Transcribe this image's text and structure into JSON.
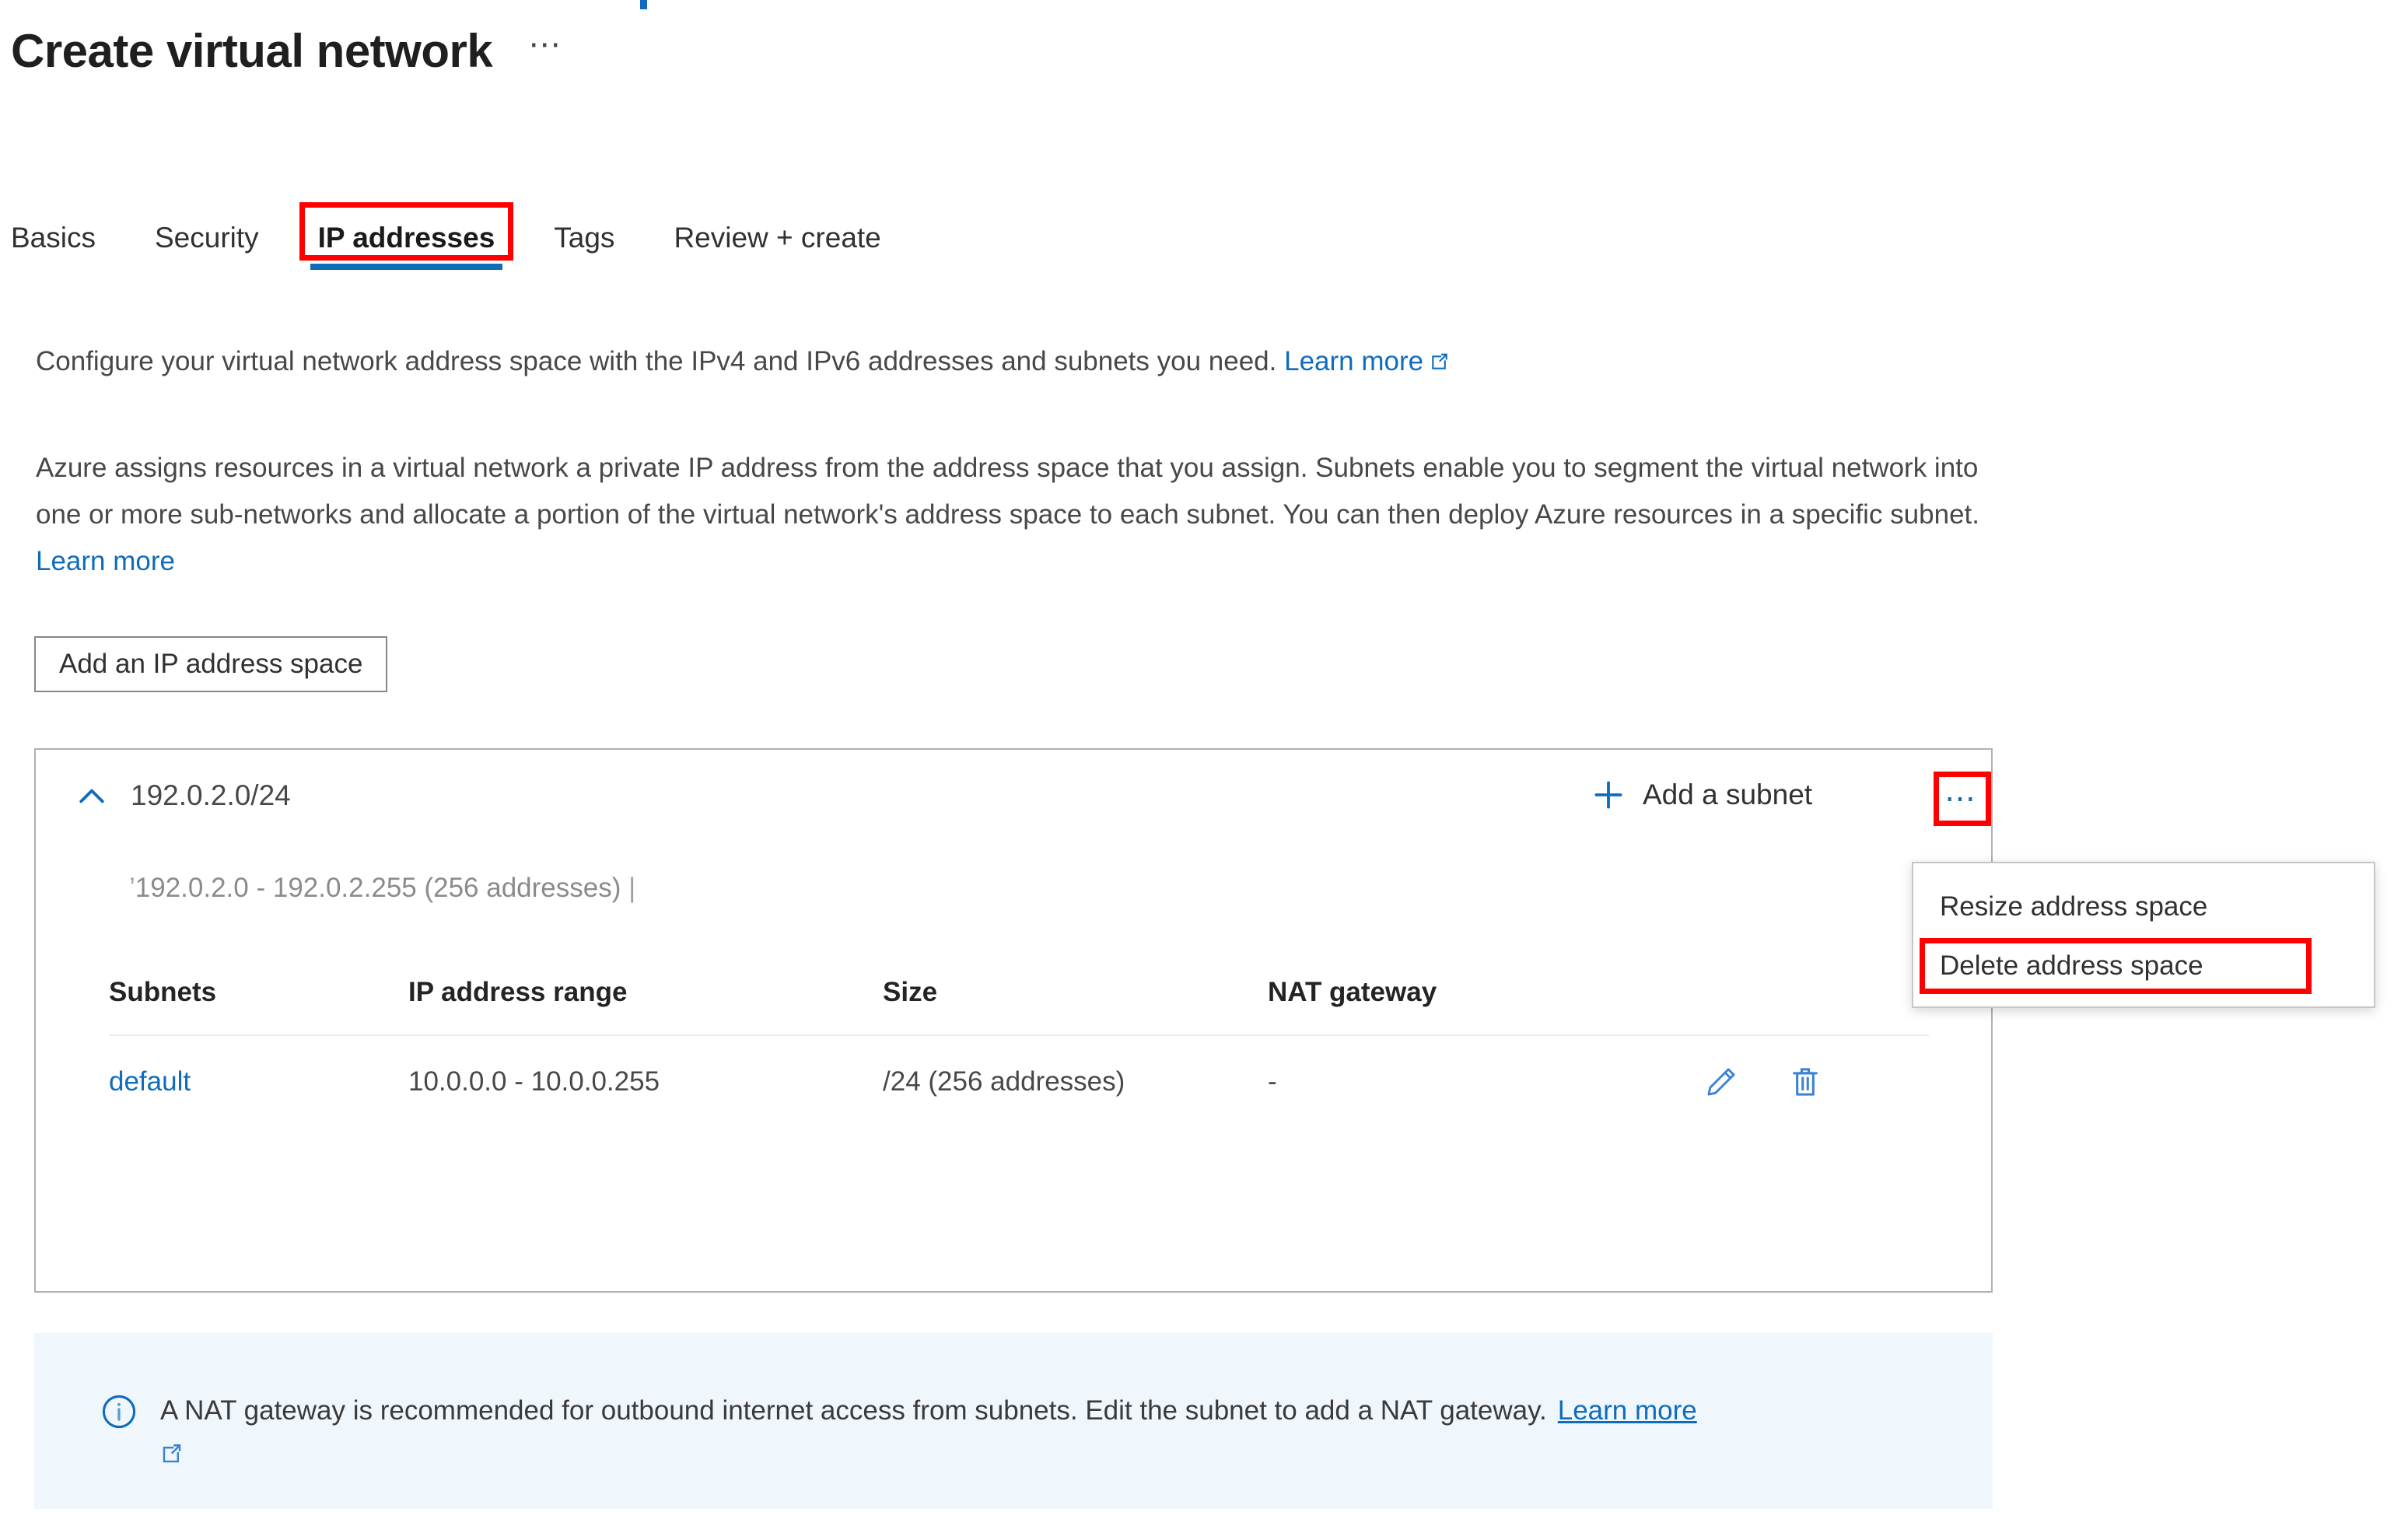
{
  "page": {
    "title": "Create virtual network",
    "title_more_label": "⋯"
  },
  "tabs": [
    {
      "label": "Basics",
      "selected": false
    },
    {
      "label": "Security",
      "selected": false
    },
    {
      "label": "IP addresses",
      "selected": true,
      "highlighted": true
    },
    {
      "label": "Tags",
      "selected": false
    },
    {
      "label": "Review + create",
      "selected": false
    }
  ],
  "intro": {
    "text": "Configure your virtual network address space with the IPv4 and IPv6 addresses and subnets you need.",
    "link_label": "Learn more",
    "link_icon": "external-link-icon"
  },
  "description": {
    "text": "Azure assigns resources in a virtual network a private IP address from the address space that you assign. Subnets enable you to segment the virtual network into one or more sub-networks and allocate a portion of the virtual network's address space to each subnet. You can then deploy Azure resources in a specific subnet.",
    "link_label": "Learn more"
  },
  "toolbar": {
    "add_address_space_label": "Add an IP address space"
  },
  "address_space": {
    "collapse_icon": "chevron-up-icon",
    "name": "192.0.2.0/24",
    "subtitle": "192.0.2.0 - 192.0.2.255 (256 addresses)",
    "add_subnet_label": "Add a subnet",
    "add_subnet_icon": "plus-icon",
    "overflow_icon": "ellipsis-icon"
  },
  "context_menu": {
    "items": [
      {
        "label": "Resize address space",
        "highlighted": false
      },
      {
        "label": "Delete address space",
        "highlighted": true
      }
    ]
  },
  "subnets_table": {
    "columns": [
      "Subnets",
      "IP address range",
      "Size",
      "NAT gateway"
    ],
    "rows": [
      {
        "subnet": "default",
        "ip_range": "10.0.0.0 - 10.0.0.255",
        "size": "/24 (256 addresses)",
        "nat_gateway": "-",
        "edit_icon": "pencil-icon",
        "delete_icon": "trash-icon"
      }
    ]
  },
  "info_banner": {
    "icon": "info-circle-icon",
    "text": "A NAT gateway is recommended for outbound internet access from subnets. Edit the subnet to add a NAT gateway.",
    "link_label": "Learn more",
    "link_icon": "external-link-icon"
  },
  "colors": {
    "accent": "#0f6cbd",
    "highlight": "#ff0000",
    "info_background": "#eff6fc",
    "text": "#323130"
  }
}
